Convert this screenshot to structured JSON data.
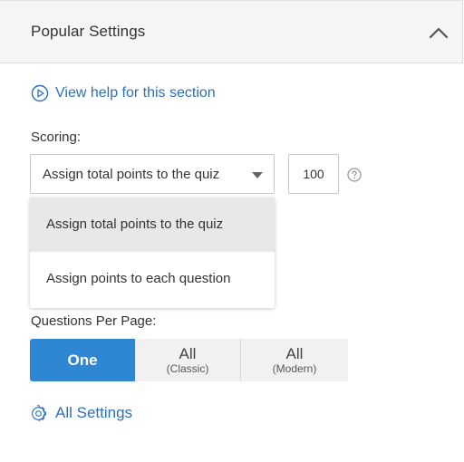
{
  "section": {
    "title": "Popular Settings",
    "collapse_icon": "chevron-up-icon"
  },
  "help": {
    "icon": "play-circle-icon",
    "label": "View help for this section"
  },
  "scoring": {
    "label": "Scoring:",
    "selected": "Assign total points to the quiz",
    "points_value": "100",
    "help_icon": "question-circle-icon",
    "options": [
      "Assign total points to the quiz",
      "Assign points to each question"
    ]
  },
  "questions_per_page": {
    "label": "Questions Per Page:",
    "options": [
      {
        "main": "One",
        "sub": "",
        "selected": true
      },
      {
        "main": "All",
        "sub": "(Classic)",
        "selected": false
      },
      {
        "main": "All",
        "sub": "(Modern)",
        "selected": false
      }
    ]
  },
  "all_settings": {
    "icon": "gear-icon",
    "label": "All Settings"
  },
  "colors": {
    "accent": "#2f86d2",
    "link": "#2f6fb6",
    "header_bg": "#f5f5f5"
  }
}
